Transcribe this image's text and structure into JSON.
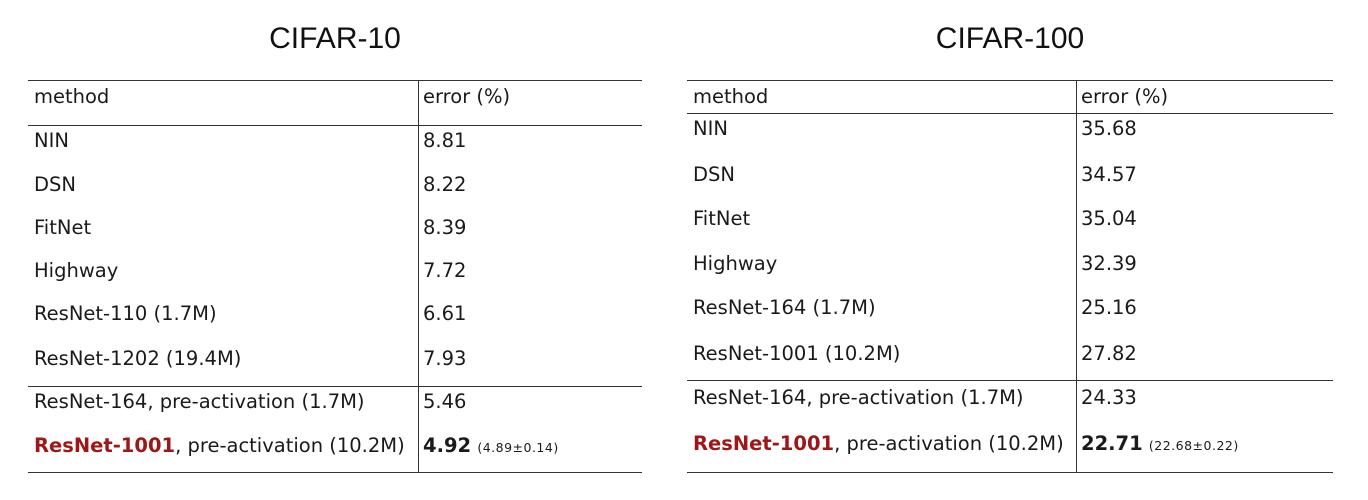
{
  "tables": [
    {
      "title": "CIFAR-10",
      "header": {
        "method": "method",
        "error": "error (%)"
      },
      "rows": [
        {
          "method": "NIN",
          "error": "8.81"
        },
        {
          "method": "DSN",
          "error": "8.22"
        },
        {
          "method": "FitNet",
          "error": "8.39"
        },
        {
          "method": "Highway",
          "error": "7.72"
        },
        {
          "method": "ResNet-110 (1.7M)",
          "error": "6.61"
        },
        {
          "method": "ResNet-1202 (19.4M)",
          "error": "7.93"
        }
      ],
      "ours": [
        {
          "method": "ResNet-164, pre-activation  (1.7M)",
          "error": "5.46"
        },
        {
          "method_highlight": "ResNet-1001",
          "method_rest": ", pre-activation  (10.2M)",
          "error": "4.92",
          "error_detail": "(4.89±0.14)"
        }
      ]
    },
    {
      "title": "CIFAR-100",
      "header": {
        "method": "method",
        "error": "error (%)"
      },
      "rows": [
        {
          "method": "NIN",
          "error": "35.68"
        },
        {
          "method": "DSN",
          "error": "34.57"
        },
        {
          "method": "FitNet",
          "error": "35.04"
        },
        {
          "method": "Highway",
          "error": "32.39"
        },
        {
          "method": "ResNet-164 (1.7M)",
          "error": "25.16"
        },
        {
          "method": "ResNet-1001 (10.2M)",
          "error": "27.82"
        }
      ],
      "ours": [
        {
          "method": "ResNet-164, pre-activation  (1.7M)",
          "error": "24.33"
        },
        {
          "method_highlight": "ResNet-1001",
          "method_rest": ", pre-activation  (10.2M)",
          "error": "22.71",
          "error_detail": "(22.68±0.22)"
        }
      ]
    }
  ],
  "colors": {
    "highlight": "#a01616",
    "rule": "#333333"
  }
}
